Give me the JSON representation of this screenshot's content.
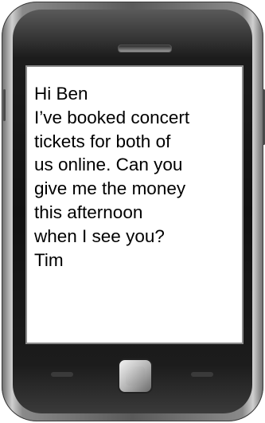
{
  "message": {
    "lines": [
      "Hi Ben",
      "I’ve booked concert",
      "tickets for both of",
      "us online. Can you",
      "give me the money",
      "this afternoon",
      "when I see you?",
      "Tim"
    ]
  },
  "icons": {
    "speaker": "speaker-grille-icon",
    "call": "call-key-icon",
    "home": "home-button-icon",
    "end": "end-call-key-icon"
  },
  "colors": {
    "screen_background": "#ffffff",
    "phone_body": "#1c1c1c",
    "text": "#000000"
  }
}
